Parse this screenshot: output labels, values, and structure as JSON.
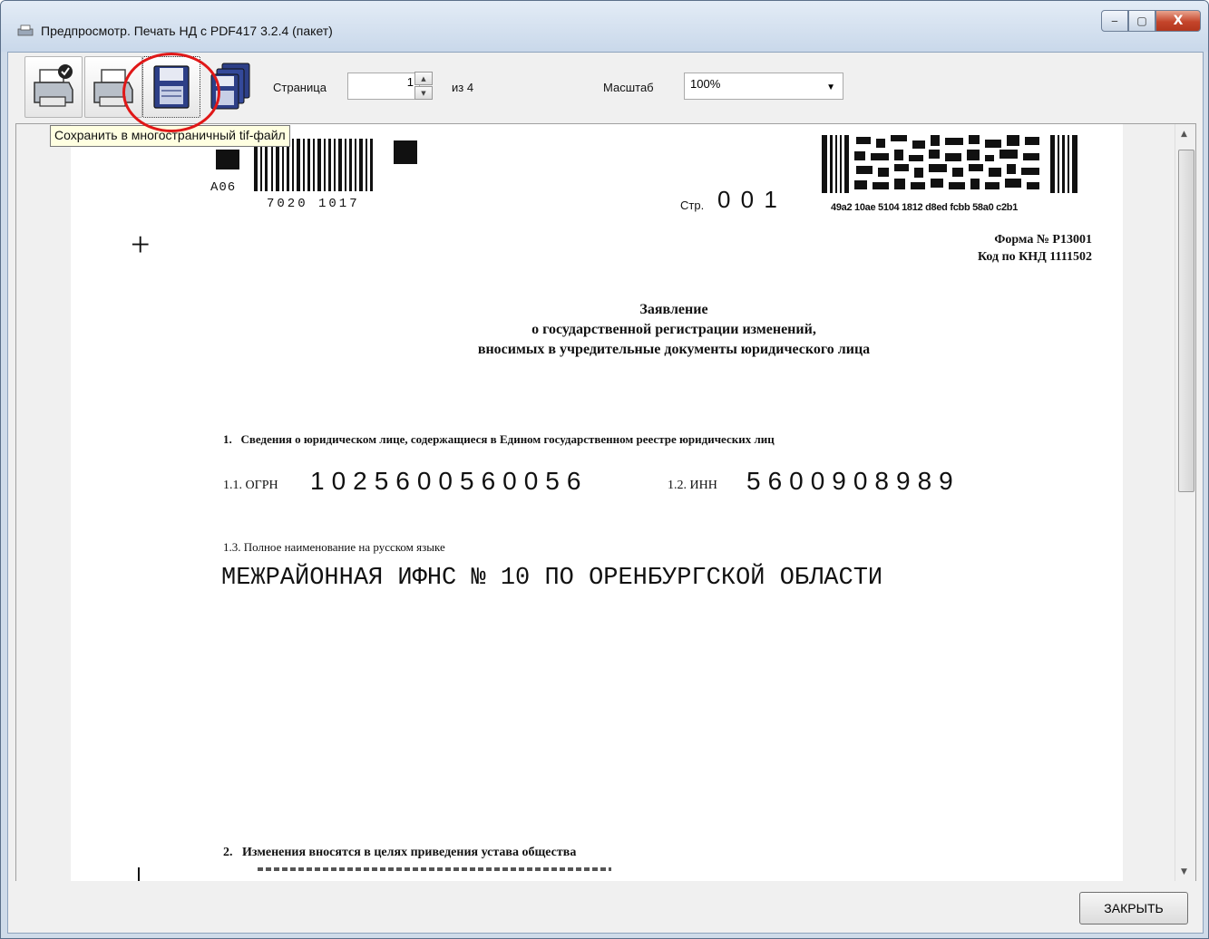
{
  "window": {
    "title": "Предпросмотр. Печать НД с PDF417 3.2.4 (пакет)",
    "minimize": "‒",
    "maximize": "▢",
    "close": "X"
  },
  "toolbar": {
    "page_label": "Страница",
    "page_value": "1",
    "page_total": "из  4",
    "zoom_label": "Масштаб",
    "zoom_value": "100%",
    "tooltip": "Сохранить в многостраничный tif-файл"
  },
  "document": {
    "barcode_code": "A06",
    "barcode_digits": "7020  1017",
    "page_label": "Стр.",
    "page_number": "0 0 1",
    "pdf417_caption": "49a2 10ae 5104 1812 d8ed fcbb 58a0 c2b1",
    "form_number": "Форма № Р13001",
    "knd_code": "Код по КНД 1111502",
    "title_line1": "Заявление",
    "title_line2": "о государственной регистрации изменений,",
    "title_line3": "вносимых в учредительные документы  юридического лица",
    "section1": "1.   Сведения о юридическом лице, содержащиеся в Едином государственном реестре юридических лиц",
    "ogrn_label": "1.1. ОГРН",
    "ogrn_value": "1025600560056",
    "inn_label": "1.2. ИНН",
    "inn_value": "5600908989",
    "full_name_label": "1.3. Полное наименование на русском языке",
    "full_name_value": "МЕЖРАЙОННАЯ ИФНС № 10 ПО ОРЕНБУРГСКОЙ ОБЛАСТИ",
    "section2": "2.   Изменения вносятся в целях приведения устава общества"
  },
  "footer": {
    "close_label": "ЗАКРЫТЬ"
  },
  "colors": {
    "highlight_circle": "#e01818",
    "tooltip_bg": "#ffffe1"
  }
}
